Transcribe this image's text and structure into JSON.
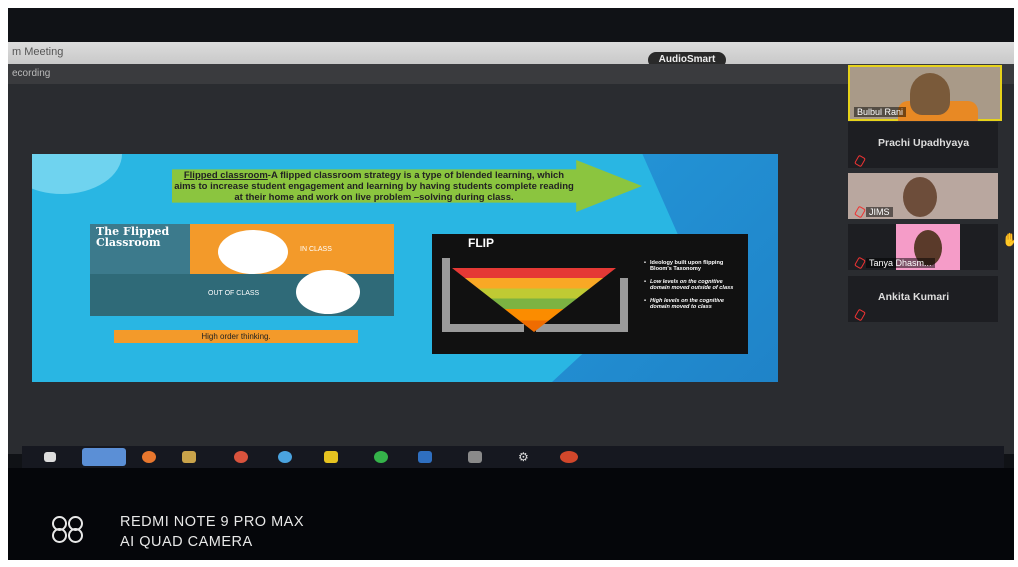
{
  "window": {
    "title": "m Meeting",
    "recording_label": "ecording",
    "audio_badge": "AudioSmart"
  },
  "slide": {
    "quote_term": "Flipped classroom",
    "quote_rest": "-A flipped classroom strategy is a type of blended learning, which aims to increase student engagement and learning by having students complete reading at their home and work on live problem –solving during class.",
    "infographic_title": "The Flipped Classroom",
    "in_class_label": "IN CLASS",
    "out_class_label": "OUT OF CLASS",
    "high_order_label": "High order thinking.",
    "flip_title": "FLIP",
    "flip_bullets": [
      "Ideology built upon flipping Bloom's Taxonomy",
      "Low levels on the cognitive domain moved outside of class",
      "High levels on the cognitive domain moved to class"
    ]
  },
  "participants": [
    {
      "name": "Bulbul Rani",
      "video": true
    },
    {
      "name": "Prachi Upadhyaya",
      "video": false
    },
    {
      "name": "JIMS",
      "video": true
    },
    {
      "name": "Tanya Dhasm...",
      "video": true
    },
    {
      "name": "Ankita Kumari",
      "video": false
    }
  ],
  "taskbar_icons": [
    "windows-start-icon",
    "zoom-icon",
    "firefox-icon",
    "file-explorer-icon",
    "chrome-icon",
    "edge-icon",
    "sticky-notes-icon",
    "whatsapp-icon",
    "word-icon",
    "store-icon",
    "settings-icon",
    "powerpoint-icon"
  ],
  "watermark": {
    "line1": "REDMI NOTE 9 PRO MAX",
    "line2": "AI QUAD CAMERA"
  }
}
